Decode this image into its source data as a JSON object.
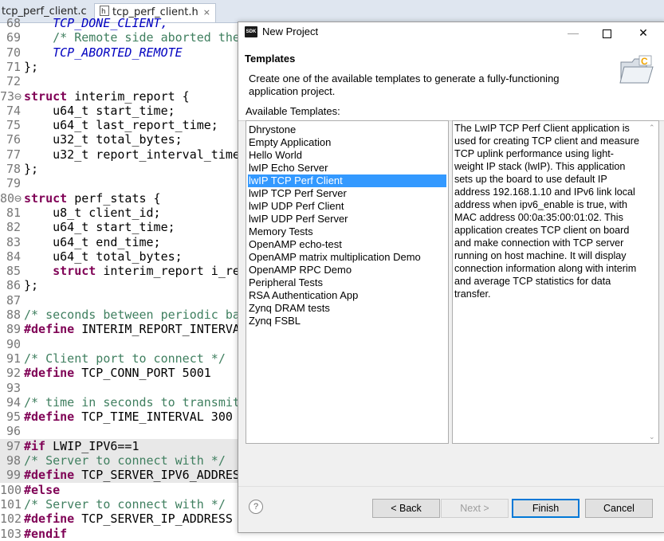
{
  "editor": {
    "tabs": [
      {
        "label": "tcp_perf_client.c"
      },
      {
        "label": "tcp_perf_client.h",
        "close": "⨯"
      }
    ],
    "lines": [
      {
        "n": "68",
        "hl": false,
        "parts": [
          {
            "c": "mac",
            "t": "    TCP_DONE_CLIENT,"
          }
        ]
      },
      {
        "n": "69",
        "hl": false,
        "parts": [
          {
            "c": "cm",
            "t": "    /* Remote side aborted the"
          }
        ]
      },
      {
        "n": "70",
        "hl": false,
        "parts": [
          {
            "c": "mac",
            "t": "    TCP_ABORTED_REMOTE"
          }
        ]
      },
      {
        "n": "71",
        "hl": false,
        "parts": [
          {
            "c": "tx",
            "t": "};"
          }
        ]
      },
      {
        "n": "72",
        "hl": false,
        "parts": []
      },
      {
        "n": "73⊖",
        "hl": false,
        "parts": [
          {
            "c": "kw",
            "t": "struct"
          },
          {
            "c": "tx",
            "t": " interim_report {"
          }
        ]
      },
      {
        "n": "74",
        "hl": false,
        "parts": [
          {
            "c": "tx",
            "t": "    u64_t start_time;"
          }
        ]
      },
      {
        "n": "75",
        "hl": false,
        "parts": [
          {
            "c": "tx",
            "t": "    u64_t last_report_time;"
          }
        ]
      },
      {
        "n": "76",
        "hl": false,
        "parts": [
          {
            "c": "tx",
            "t": "    u32_t total_bytes;"
          }
        ]
      },
      {
        "n": "77",
        "hl": false,
        "parts": [
          {
            "c": "tx",
            "t": "    u32_t report_interval_time"
          }
        ]
      },
      {
        "n": "78",
        "hl": false,
        "parts": [
          {
            "c": "tx",
            "t": "};"
          }
        ]
      },
      {
        "n": "79",
        "hl": false,
        "parts": []
      },
      {
        "n": "80⊖",
        "hl": false,
        "parts": [
          {
            "c": "kw",
            "t": "struct"
          },
          {
            "c": "tx",
            "t": " perf_stats {"
          }
        ]
      },
      {
        "n": "81",
        "hl": false,
        "parts": [
          {
            "c": "tx",
            "t": "    u8_t client_id;"
          }
        ]
      },
      {
        "n": "82",
        "hl": false,
        "parts": [
          {
            "c": "tx",
            "t": "    u64_t start_time;"
          }
        ]
      },
      {
        "n": "83",
        "hl": false,
        "parts": [
          {
            "c": "tx",
            "t": "    u64_t end_time;"
          }
        ]
      },
      {
        "n": "84",
        "hl": false,
        "parts": [
          {
            "c": "tx",
            "t": "    u64_t total_bytes;"
          }
        ]
      },
      {
        "n": "85",
        "hl": false,
        "parts": [
          {
            "c": "tx",
            "t": "    "
          },
          {
            "c": "kw",
            "t": "struct"
          },
          {
            "c": "tx",
            "t": " interim_report i_re"
          }
        ]
      },
      {
        "n": "86",
        "hl": false,
        "parts": [
          {
            "c": "tx",
            "t": "};"
          }
        ]
      },
      {
        "n": "87",
        "hl": false,
        "parts": []
      },
      {
        "n": "88",
        "hl": false,
        "parts": [
          {
            "c": "cm",
            "t": "/* seconds between periodic ba"
          }
        ]
      },
      {
        "n": "89",
        "hl": false,
        "parts": [
          {
            "c": "kw",
            "t": "#define"
          },
          {
            "c": "tx",
            "t": " INTERIM_REPORT_INTERVA"
          }
        ]
      },
      {
        "n": "90",
        "hl": false,
        "parts": []
      },
      {
        "n": "91",
        "hl": false,
        "parts": [
          {
            "c": "cm",
            "t": "/* Client port to connect */"
          }
        ]
      },
      {
        "n": "92",
        "hl": false,
        "parts": [
          {
            "c": "kw",
            "t": "#define"
          },
          {
            "c": "tx",
            "t": " TCP_CONN_PORT 5001"
          }
        ]
      },
      {
        "n": "93",
        "hl": false,
        "parts": []
      },
      {
        "n": "94",
        "hl": false,
        "parts": [
          {
            "c": "cm",
            "t": "/* time in seconds to transmit"
          }
        ]
      },
      {
        "n": "95",
        "hl": false,
        "parts": [
          {
            "c": "kw",
            "t": "#define"
          },
          {
            "c": "tx",
            "t": " TCP_TIME_INTERVAL 300"
          }
        ]
      },
      {
        "n": "96",
        "hl": false,
        "parts": []
      },
      {
        "n": "97",
        "hl": true,
        "parts": [
          {
            "c": "kw",
            "t": "#if"
          },
          {
            "c": "tx",
            "t": " LWIP_IPV6==1"
          }
        ]
      },
      {
        "n": "98",
        "hl": true,
        "parts": [
          {
            "c": "cm",
            "t": "/* Server to connect with */"
          }
        ]
      },
      {
        "n": "99",
        "hl": true,
        "parts": [
          {
            "c": "kw",
            "t": "#define"
          },
          {
            "c": "tx",
            "t": " TCP_SERVER_IPV6_ADDRES"
          }
        ]
      },
      {
        "n": "100",
        "hl": false,
        "parts": [
          {
            "c": "kw",
            "t": "#else"
          }
        ]
      },
      {
        "n": "101",
        "hl": false,
        "parts": [
          {
            "c": "cm",
            "t": "/* Server to connect with */"
          }
        ]
      },
      {
        "n": "102",
        "hl": false,
        "parts": [
          {
            "c": "kw",
            "t": "#define"
          },
          {
            "c": "tx",
            "t": " TCP_SERVER_IP_ADDRESS"
          }
        ]
      },
      {
        "n": "103",
        "hl": false,
        "parts": [
          {
            "c": "kw",
            "t": "#endif"
          }
        ]
      }
    ]
  },
  "dialog": {
    "icon_label": "SDK",
    "title": "New Project",
    "window_buttons": {
      "minimize": "—",
      "close": "✕"
    },
    "header_title": "Templates",
    "header_desc": "Create one of the available templates to generate a fully-functioning application project.",
    "available_label": "Available Templates:",
    "templates": [
      "Dhrystone",
      "Empty Application",
      "Hello World",
      "lwIP Echo Server",
      "lwIP TCP Perf Client",
      "lwIP TCP Perf Server",
      "lwIP UDP Perf Client",
      "lwIP UDP Perf Server",
      "Memory Tests",
      "OpenAMP echo-test",
      "OpenAMP matrix multiplication Demo",
      "OpenAMP RPC Demo",
      "Peripheral Tests",
      "RSA Authentication App",
      "Zynq DRAM tests",
      "Zynq FSBL"
    ],
    "selected_index": 4,
    "description": "The LwIP TCP Perf Client application is used for creating TCP client and measure TCP uplink performance using light-weight IP stack (lwIP). This application sets up the board to use default IP address 192.168.1.10 and IPv6 link local address when ipv6_enable is true, with MAC address 00:0a:35:00:01:02. This application creates TCP client on board and make connection with TCP server running on host machine. It will display connection information along with interim and average TCP statistics for data transfer.",
    "help_label": "?",
    "buttons": {
      "back": "< Back",
      "next": "Next >",
      "finish": "Finish",
      "cancel": "Cancel"
    }
  }
}
